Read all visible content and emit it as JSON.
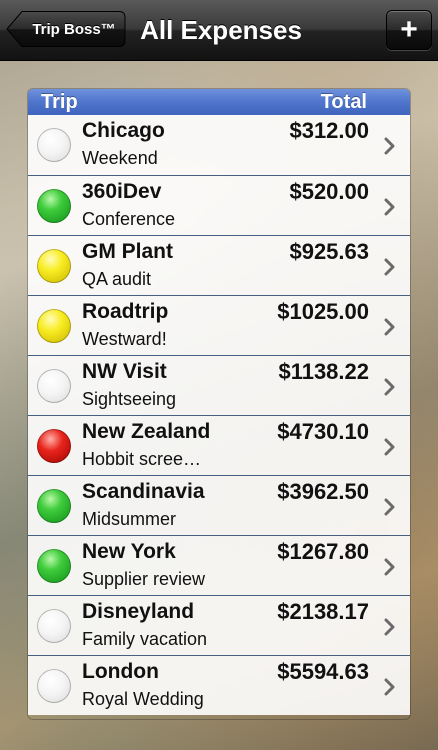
{
  "nav": {
    "back_label": "Trip Boss™",
    "title": "All Expenses",
    "add_label": "+"
  },
  "table": {
    "header_trip": "Trip",
    "header_total": "Total",
    "rows": [
      {
        "name": "Chicago",
        "subtitle": "Weekend",
        "total": "$312.00",
        "status": "none"
      },
      {
        "name": "360iDev",
        "subtitle": "Conference",
        "total": "$520.00",
        "status": "green"
      },
      {
        "name": "GM Plant",
        "subtitle": "QA audit",
        "total": "$925.63",
        "status": "yellow"
      },
      {
        "name": "Roadtrip",
        "subtitle": "Westward!",
        "total": "$1025.00",
        "status": "yellow"
      },
      {
        "name": "NW Visit",
        "subtitle": "Sightseeing",
        "total": "$1138.22",
        "status": "none"
      },
      {
        "name": "New Zealand",
        "subtitle": "Hobbit scree…",
        "total": "$4730.10",
        "status": "red"
      },
      {
        "name": "Scandinavia",
        "subtitle": "Midsummer",
        "total": "$3962.50",
        "status": "green"
      },
      {
        "name": "New York",
        "subtitle": "Supplier review",
        "total": "$1267.80",
        "status": "green"
      },
      {
        "name": "Disneyland",
        "subtitle": "Family vacation",
        "total": "$2138.17",
        "status": "none"
      },
      {
        "name": "London",
        "subtitle": "Royal Wedding",
        "total": "$5594.63",
        "status": "none"
      }
    ]
  }
}
